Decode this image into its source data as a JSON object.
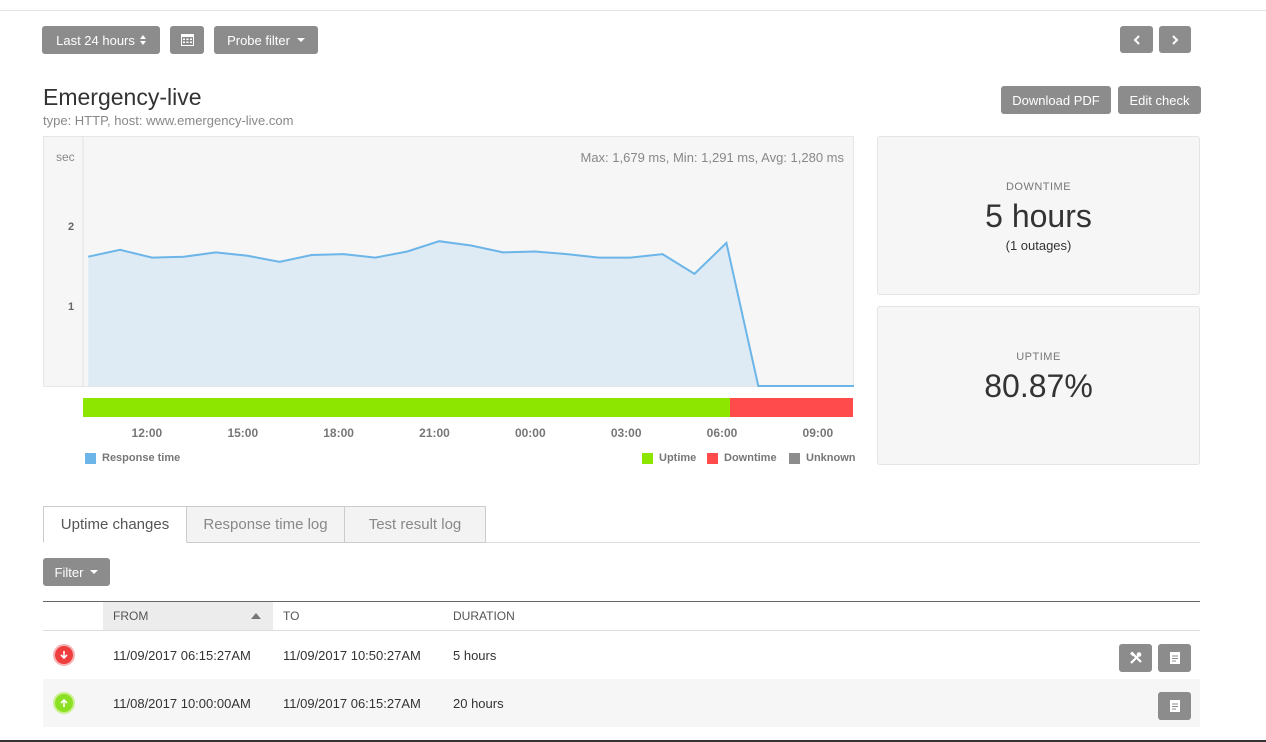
{
  "toolbar": {
    "range_label": "Last 24 hours",
    "probe_filter_label": "Probe filter",
    "calendar_icon": "calendar-icon",
    "prev_icon": "chevron-left-icon",
    "next_icon": "chevron-right-icon"
  },
  "check": {
    "name": "Emergency-live",
    "subtitle": "type: HTTP, host: www.emergency-live.com",
    "download_pdf_label": "Download PDF",
    "edit_check_label": "Edit check"
  },
  "chart_data": {
    "type": "area",
    "unit_label": "sec",
    "stats_text": "Max: 1,679 ms, Min: 1,291 ms, Avg: 1,280 ms",
    "yticks": [
      {
        "label": "2",
        "value": 2
      },
      {
        "label": "1",
        "value": 1
      }
    ],
    "ylim": [
      0,
      2.9
    ],
    "x_ticks": [
      "12:00",
      "15:00",
      "18:00",
      "21:00",
      "00:00",
      "03:00",
      "06:00",
      "09:00"
    ],
    "x_tick_hours": [
      12,
      15,
      18,
      21,
      24,
      27,
      30,
      33
    ],
    "xlim_hours": [
      10.0,
      34.1
    ],
    "series": [
      {
        "name": "Response time",
        "color": "#6cb5e8",
        "x_hours": [
          10.1,
          11.1,
          12.1,
          13.1,
          14.1,
          15.1,
          16.1,
          17.1,
          18.1,
          19.1,
          20.1,
          21.1,
          22.1,
          23.1,
          24.1,
          25.1,
          26.1,
          27.1,
          28.1,
          29.1,
          30.1,
          31.1,
          32.1,
          33.1,
          34.1
        ],
        "values": [
          1.5,
          1.58,
          1.49,
          1.5,
          1.55,
          1.51,
          1.44,
          1.52,
          1.53,
          1.49,
          1.56,
          1.68,
          1.63,
          1.55,
          1.56,
          1.53,
          1.49,
          1.49,
          1.53,
          1.3,
          1.66,
          0.0,
          0.0,
          0.0,
          0.0
        ]
      }
    ],
    "status_bar": [
      {
        "status": "Uptime",
        "from_hours": 10.0,
        "to_hours": 30.25,
        "color": "#8ce600"
      },
      {
        "status": "Downtime",
        "from_hours": 30.25,
        "to_hours": 34.1,
        "color": "#ff4b4b"
      }
    ],
    "legend_left": [
      {
        "label": "Response time",
        "color": "#6cb5e8"
      }
    ],
    "legend_right": [
      {
        "label": "Uptime",
        "color": "#8ce600"
      },
      {
        "label": "Downtime",
        "color": "#ff4b4b"
      },
      {
        "label": "Unknown",
        "color": "#8c8c8c"
      }
    ]
  },
  "downtime": {
    "label": "DOWNTIME",
    "value": "5 hours",
    "outages": "(1 outages)"
  },
  "uptime": {
    "label": "UPTIME",
    "value": "80.87%"
  },
  "tabs": [
    {
      "label": "Uptime changes",
      "active": true
    },
    {
      "label": "Response time log",
      "active": false
    },
    {
      "label": "Test result log",
      "active": false
    }
  ],
  "filter_label": "Filter",
  "table": {
    "headers": {
      "from": "FROM",
      "to": "TO",
      "duration": "DURATION"
    },
    "rows": [
      {
        "status": "down",
        "from": "11/09/2017 06:15:27AM",
        "to": "11/09/2017 10:50:27AM",
        "duration": "5 hours",
        "actions": [
          "tools-icon",
          "notes-icon"
        ]
      },
      {
        "status": "up",
        "from": "11/08/2017 10:00:00AM",
        "to": "11/09/2017 06:15:27AM",
        "duration": "20 hours",
        "actions": [
          "notes-icon"
        ]
      }
    ]
  }
}
